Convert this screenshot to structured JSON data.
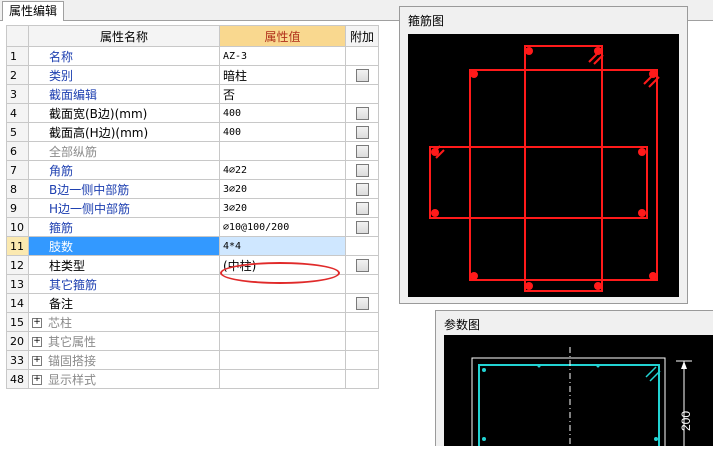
{
  "tab": {
    "label": "属性编辑"
  },
  "table": {
    "headers": {
      "name": "属性名称",
      "value": "属性值",
      "extra": "附加"
    },
    "rows": [
      {
        "num": "1",
        "name": "名称",
        "value": "AZ-3",
        "check": false
      },
      {
        "num": "2",
        "name": "类别",
        "value": "暗柱",
        "check": true
      },
      {
        "num": "3",
        "name": "截面编辑",
        "value": "否",
        "check": false
      },
      {
        "num": "4",
        "name": "截面宽(B边)(mm)",
        "value": "400",
        "check": true
      },
      {
        "num": "5",
        "name": "截面高(H边)(mm)",
        "value": "400",
        "check": true
      },
      {
        "num": "6",
        "name": "全部纵筋",
        "value": "",
        "check": true
      },
      {
        "num": "7",
        "name": "角筋",
        "value": "4⌀22",
        "check": true
      },
      {
        "num": "8",
        "name": "B边一侧中部筋",
        "value": "3⌀20",
        "check": true
      },
      {
        "num": "9",
        "name": "H边一侧中部筋",
        "value": "3⌀20",
        "check": true
      },
      {
        "num": "10",
        "name": "箍筋",
        "value": "⌀10@100/200",
        "check": true
      },
      {
        "num": "11",
        "name": "肢数",
        "value": "4*4",
        "check": false
      },
      {
        "num": "12",
        "name": "柱类型",
        "value": "(中柱)",
        "check": true
      },
      {
        "num": "13",
        "name": "其它箍筋",
        "value": "",
        "check": false
      },
      {
        "num": "14",
        "name": "备注",
        "value": "",
        "check": true
      },
      {
        "num": "15",
        "name": "芯柱",
        "value": "",
        "check": false
      },
      {
        "num": "20",
        "name": "其它属性",
        "value": "",
        "check": false
      },
      {
        "num": "33",
        "name": "锚固搭接",
        "value": "",
        "check": false
      },
      {
        "num": "48",
        "name": "显示样式",
        "value": "",
        "check": false
      }
    ]
  },
  "stirrup_panel": {
    "title": "箍筋图"
  },
  "param_panel": {
    "title": "参数图",
    "dimension": "200"
  },
  "colors": {
    "rebar": "#ff1a1a",
    "param_line": "#22d3d3",
    "selection": "#3399ff",
    "annotation": "#e02a2a"
  }
}
